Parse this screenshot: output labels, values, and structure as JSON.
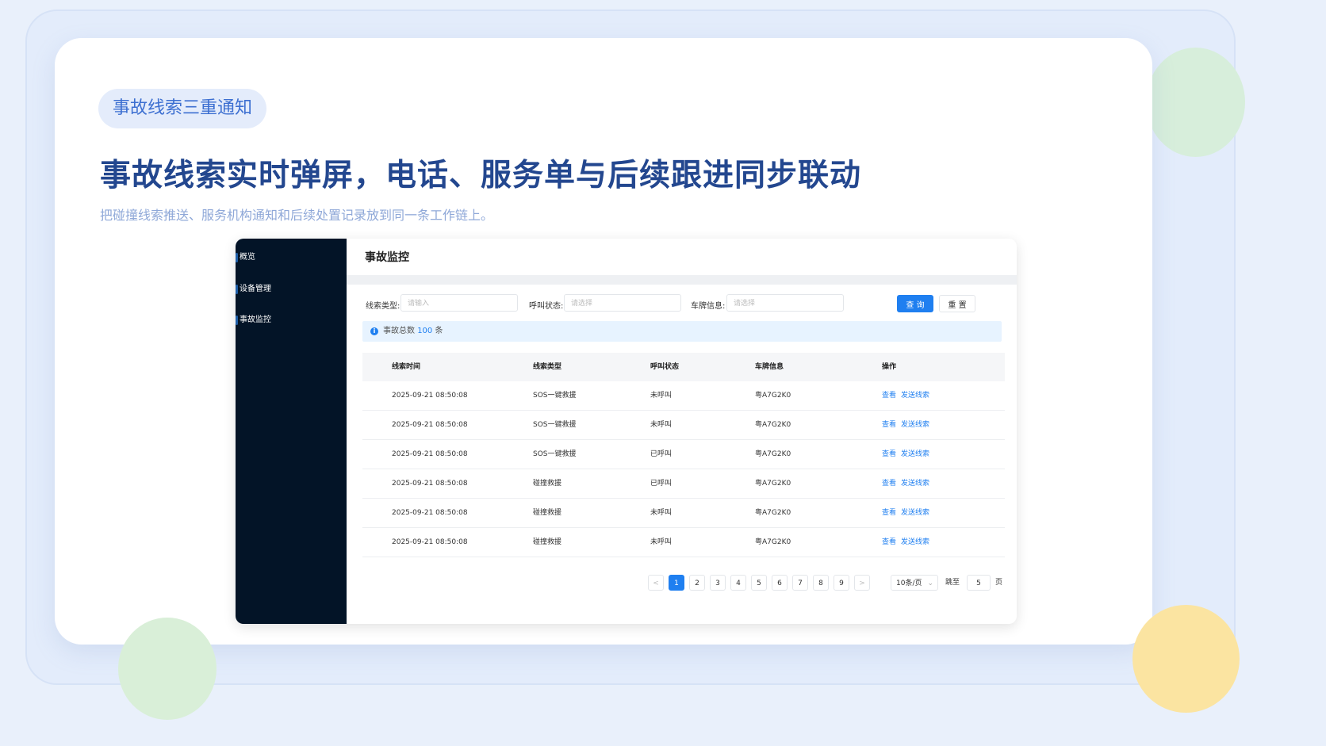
{
  "slide": {
    "tag": "事故线索三重通知",
    "headline": "事故线索实时弹屏，电话、服务单与后续跟进同步联动",
    "subline": "把碰撞线索推送、服务机构通知和后续处置记录放到同一条工作链上。"
  },
  "sidebar": {
    "items": [
      {
        "label": "概览"
      },
      {
        "label": "设备管理"
      },
      {
        "label": "事故监控"
      }
    ]
  },
  "page": {
    "title": "事故监控"
  },
  "filters": {
    "clue_type_label": "线索类型:",
    "clue_type_placeholder": "请输入",
    "call_status_label": "呼叫状态:",
    "call_status_placeholder": "请选择",
    "plate_label": "车牌信息:",
    "plate_placeholder": "请选择",
    "query_label": "查 询",
    "reset_label": "重 置"
  },
  "alert": {
    "prefix": "事故总数",
    "count": "100",
    "suffix": "条"
  },
  "table": {
    "columns": [
      "线索时间",
      "线索类型",
      "呼叫状态",
      "车牌信息",
      "操作"
    ],
    "view_label": "查看",
    "send_label": "发送线索",
    "rows": [
      {
        "time": "2025-09-21  08:50:08",
        "type": "SOS一键救援",
        "status": "未呼叫",
        "plate": "粤A7G2K0"
      },
      {
        "time": "2025-09-21  08:50:08",
        "type": "SOS一键救援",
        "status": "未呼叫",
        "plate": "粤A7G2K0"
      },
      {
        "time": "2025-09-21  08:50:08",
        "type": "SOS一键救援",
        "status": "已呼叫",
        "plate": "粤A7G2K0"
      },
      {
        "time": "2025-09-21  08:50:08",
        "type": "碰撞救援",
        "status": "已呼叫",
        "plate": "粤A7G2K0"
      },
      {
        "time": "2025-09-21  08:50:08",
        "type": "碰撞救援",
        "status": "未呼叫",
        "plate": "粤A7G2K0"
      },
      {
        "time": "2025-09-21  08:50:08",
        "type": "碰撞救援",
        "status": "未呼叫",
        "plate": "粤A7G2K0"
      }
    ]
  },
  "pagination": {
    "prev": "<",
    "next": ">",
    "pages": [
      "1",
      "2",
      "3",
      "4",
      "5",
      "6",
      "7",
      "8",
      "9"
    ],
    "current": "1",
    "page_size": "10条/页",
    "jump_label": "跳至",
    "jump_value": "5",
    "page_unit": "页"
  },
  "colors": {
    "accent": "#1f7ff0",
    "sidebar_bg": "#031427",
    "headline": "#23478f"
  }
}
